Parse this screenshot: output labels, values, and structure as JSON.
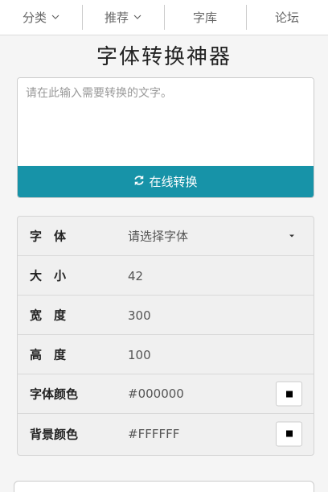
{
  "nav": {
    "items": [
      {
        "label": "分类",
        "has_dropdown": true,
        "icon": "chevron-down-icon"
      },
      {
        "label": "推荐",
        "has_dropdown": true,
        "icon": "chevron-down-icon"
      },
      {
        "label": "字库",
        "has_dropdown": false
      },
      {
        "label": "论坛",
        "has_dropdown": false
      }
    ]
  },
  "page": {
    "title": "字体转换神器"
  },
  "input": {
    "placeholder": "请在此输入需要转换的文字。",
    "value": ""
  },
  "convert_button": {
    "label": "在线转换",
    "icon": "refresh-icon",
    "color": "#1793a8"
  },
  "settings": {
    "font": {
      "label": "字　体",
      "value": "请选择字体"
    },
    "size": {
      "label": "大　小",
      "value": "42"
    },
    "width": {
      "label": "宽　度",
      "value": "300"
    },
    "height": {
      "label": "高　度",
      "value": "100"
    },
    "font_color": {
      "label": "字体颜色",
      "value": "#000000",
      "swatch": "#000000"
    },
    "bg_color": {
      "label": "背景颜色",
      "value": "#FFFFFF",
      "swatch": "#FFFFFF"
    }
  }
}
